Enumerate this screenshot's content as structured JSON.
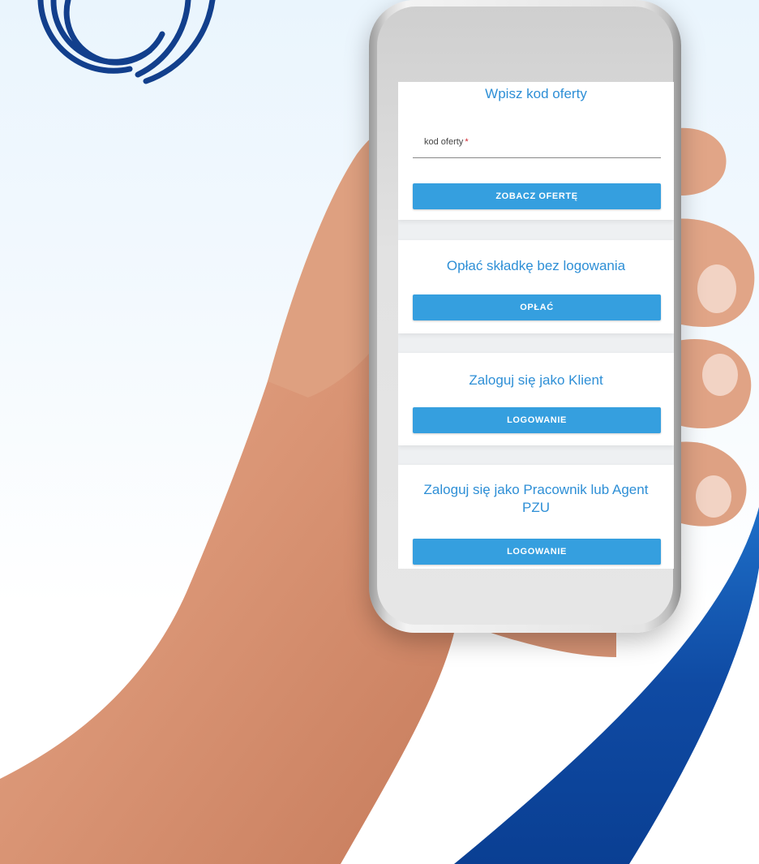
{
  "colors": {
    "brand_blue": "#1a4fa0",
    "accent": "#359fdf",
    "title_blue": "#2e8fd6",
    "required_red": "#d0262f"
  },
  "offer_card": {
    "title": "Wpisz kod oferty",
    "field_label": "kod oferty",
    "required_mark": "*",
    "field_value": "",
    "button_label": "ZOBACZ OFERTĘ"
  },
  "pay_card": {
    "title": "Opłać składkę bez logowania",
    "button_label": "OPŁAĆ"
  },
  "client_card": {
    "title": "Zaloguj się jako Klient",
    "button_label": "LOGOWANIE"
  },
  "agent_card": {
    "title": "Zaloguj się jako Pracownik lub Agent PZU",
    "button_label": "LOGOWANIE"
  }
}
